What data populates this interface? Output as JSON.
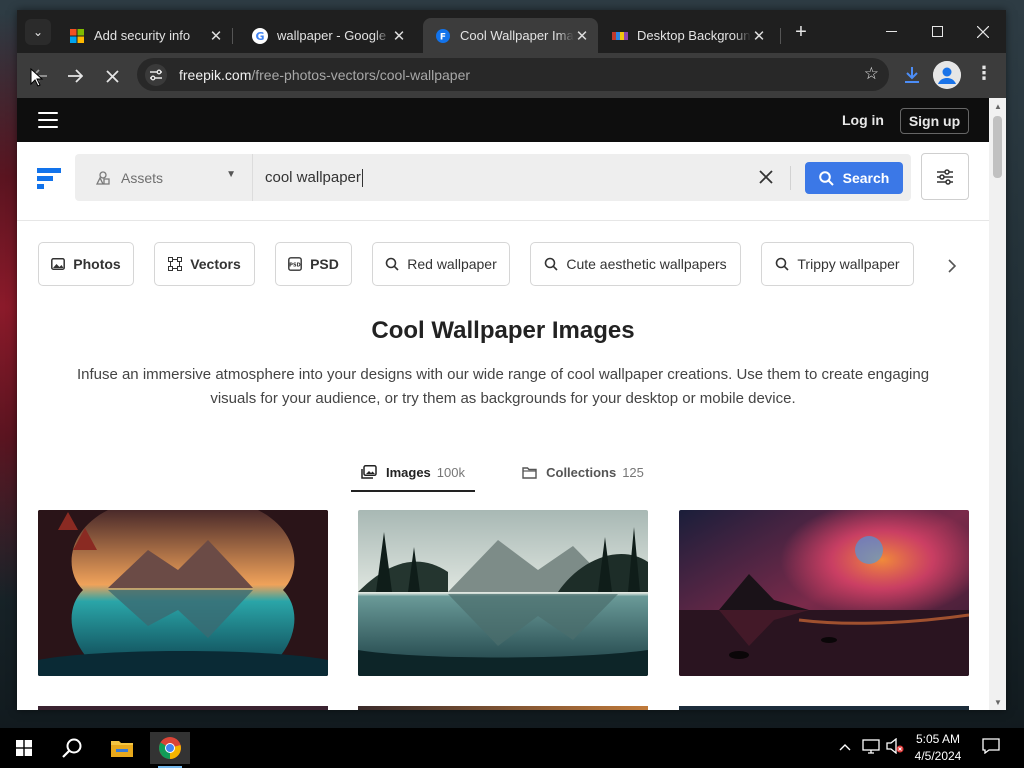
{
  "browser": {
    "tabs": [
      {
        "title": "Add security info",
        "favicon": "microsoft-icon",
        "active": false
      },
      {
        "title": "wallpaper - Google Search",
        "favicon": "google-icon",
        "active": false
      },
      {
        "title": "Cool Wallpaper Images",
        "favicon": "freepik-icon",
        "active": true
      },
      {
        "title": "Desktop Backgrounds",
        "favicon": "wallpaper-site-icon",
        "active": false
      }
    ],
    "new_tab": "+",
    "close_glyph": "✕",
    "url_host": "freepik.com",
    "url_path": "/free-photos-vectors/cool-wallpaper"
  },
  "site": {
    "nav": {
      "login": "Log in",
      "signup": "Sign up"
    },
    "search": {
      "asset_type": "Assets",
      "query": "cool wallpaper",
      "button": "Search"
    },
    "chips": [
      {
        "label": "Photos",
        "icon": "image-icon",
        "kind": "category"
      },
      {
        "label": "Vectors",
        "icon": "vector-icon",
        "kind": "category"
      },
      {
        "label": "PSD",
        "icon": "psd-icon",
        "kind": "category"
      },
      {
        "label": "Red wallpaper",
        "icon": "search-icon",
        "kind": "suggestion"
      },
      {
        "label": "Cute aesthetic wallpapers",
        "icon": "search-icon",
        "kind": "suggestion"
      },
      {
        "label": "Trippy wallpaper",
        "icon": "search-icon",
        "kind": "suggestion"
      }
    ],
    "heading": "Cool Wallpaper Images",
    "description": "Infuse an immersive atmosphere into your designs with our wide range of cool wallpaper creations. Use them to create engaging visuals for your audience, or try them as backgrounds for your desktop or mobile device.",
    "result_tabs": [
      {
        "label": "Images",
        "count": "100k",
        "active": true
      },
      {
        "label": "Collections",
        "count": "125",
        "active": false
      }
    ]
  },
  "taskbar": {
    "time": "5:05 AM",
    "date": "4/5/2024"
  },
  "colors": {
    "search_button": "#3b78e7",
    "freepik_blue": "#1273eb",
    "browser_dark": "#1f1f1f"
  }
}
